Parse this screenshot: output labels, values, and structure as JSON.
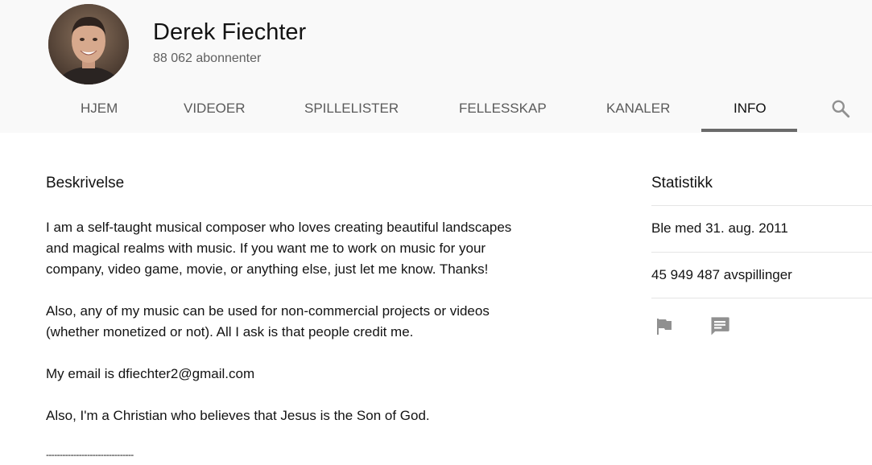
{
  "channel": {
    "name": "Derek Fiechter",
    "subscribers": "88 062 abonnenter"
  },
  "tabs": [
    {
      "label": "HJEM",
      "active": false
    },
    {
      "label": "VIDEOER",
      "active": false
    },
    {
      "label": "SPILLELISTER",
      "active": false
    },
    {
      "label": "FELLESSKAP",
      "active": false
    },
    {
      "label": "KANALER",
      "active": false
    },
    {
      "label": "INFO",
      "active": true
    }
  ],
  "description": {
    "title": "Beskrivelse",
    "lines": [
      "I am a self-taught musical composer who loves creating beautiful landscapes",
      "and magical realms with music. If you want me to work on music for your",
      "company, video game, movie, or anything else, just let me know. Thanks!",
      "Also, any of my music can be used for non-commercial projects or videos",
      "(whether monetized or not). All I ask is that people credit me.",
      "My email is dfiechter2@gmail.com",
      "Also, I'm a Christian who believes that Jesus is the Son of God.",
      "--------------------------------"
    ]
  },
  "stats": {
    "title": "Statistikk",
    "joined": "Ble med 31. aug. 2011",
    "views": "45 949 487 avspillinger"
  },
  "icons": {
    "search": "search-icon",
    "flag": "flag-icon",
    "message": "message-icon"
  },
  "colors": {
    "header_bg": "#f9f9f9",
    "tab_underline": "#6a6a6a",
    "icon_gray": "#909090"
  }
}
